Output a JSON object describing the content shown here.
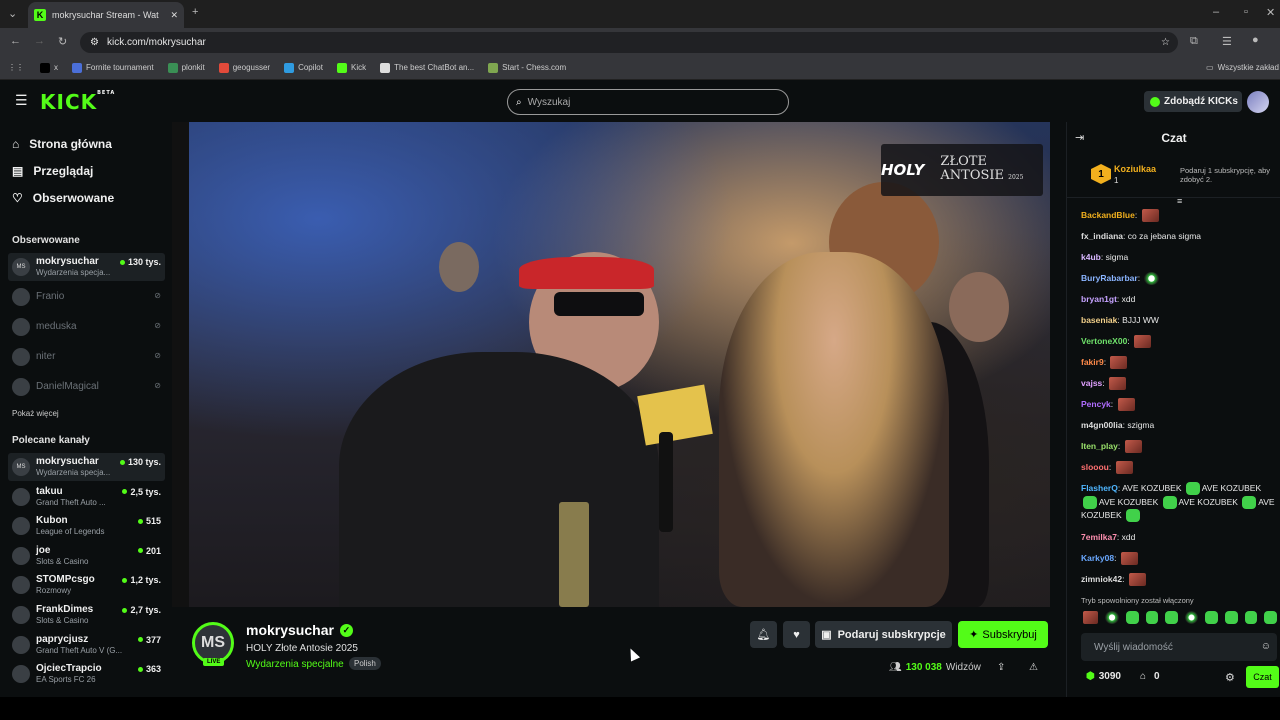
{
  "browser": {
    "tab_title": "mokrysuchar Stream - Wat",
    "url": "kick.com/mokrysuchar",
    "bookmarks": [
      {
        "label": "x",
        "color": "#000000"
      },
      {
        "label": "Fornite tournament",
        "color": "#4b6fd8"
      },
      {
        "label": "plonkit",
        "color": "#3a8f55"
      },
      {
        "label": "geogusser",
        "color": "#e24a3a"
      },
      {
        "label": "Copilot",
        "color": "#2f9be0"
      },
      {
        "label": "Kick",
        "color": "#53fc18"
      },
      {
        "label": "The best ChatBot an...",
        "color": "#dddddd"
      },
      {
        "label": "Start - Chess.com",
        "color": "#7fa650"
      }
    ],
    "other_bookmarks": "Wszystkie zakład"
  },
  "header": {
    "logo": "KICK",
    "logo_sup": "BETA",
    "search_placeholder": "Wyszukaj",
    "get_kicks": "Zdobądź KICKs"
  },
  "sidebar": {
    "nav": [
      "Strona główna",
      "Przeglądaj",
      "Obserwowane"
    ],
    "followed_title": "Obserwowane",
    "followed": [
      {
        "initials": "MS",
        "name": "mokrysuchar",
        "category": "Wydarzenia specja...",
        "viewers": "130 tys.",
        "live": true
      },
      {
        "initials": "",
        "name": "Franio",
        "live": false
      },
      {
        "initials": "",
        "name": "meduska",
        "live": false
      },
      {
        "initials": "",
        "name": "niter",
        "live": false
      },
      {
        "initials": "",
        "name": "DanielMagical",
        "live": false
      }
    ],
    "show_more": "Pokaż więcej",
    "recommended_title": "Polecane kanały",
    "recommended": [
      {
        "initials": "MS",
        "name": "mokrysuchar",
        "category": "Wydarzenia specja...",
        "viewers": "130 tys."
      },
      {
        "initials": "",
        "name": "takuu",
        "category": "Grand Theft Auto ...",
        "viewers": "2,5 tys."
      },
      {
        "initials": "",
        "name": "Kubon",
        "category": "League of Legends",
        "viewers": "515"
      },
      {
        "initials": "",
        "name": "joe",
        "category": "Slots & Casino",
        "viewers": "201"
      },
      {
        "initials": "",
        "name": "STOMPcsgo",
        "category": "Rozmowy",
        "viewers": "1,2 tys."
      },
      {
        "initials": "",
        "name": "FrankDimes",
        "category": "Slots & Casino",
        "viewers": "2,7 tys."
      },
      {
        "initials": "",
        "name": "paprycjusz",
        "category": "Grand Theft Auto V (G...",
        "viewers": "377"
      },
      {
        "initials": "",
        "name": "OjciecTrapcio",
        "category": "EA Sports FC 26",
        "viewers": "363"
      }
    ]
  },
  "video": {
    "overlay_brand": "HOLY",
    "overlay_title": "ZŁOTE ANTOSIE",
    "overlay_year": "2025"
  },
  "stream": {
    "initials": "MS",
    "live": "LIVE",
    "channel": "mokrysuchar",
    "title": "HOLY Złote Antosie 2025",
    "category": "Wydarzenia specjalne",
    "language": "Polish",
    "gift_label": "Podaruj subskrypcje",
    "subscribe_label": "Subskrybuj",
    "viewers": "130 038",
    "viewers_label": "Widzów"
  },
  "chat": {
    "title": "Czat",
    "pinned_user": "Koziulkaa",
    "pinned_rank": "1",
    "pinned_count": "1",
    "pinned_note": "Podaruj 1 subskrypcję, aby zdobyć 2.",
    "messages": [
      {
        "user": "BackandBlue",
        "color": "#f2b01e",
        "text": "",
        "emotes": [
          "face"
        ]
      },
      {
        "user": "fx_indiana",
        "color": "#dddddd",
        "text": "co za jebana sigma",
        "emotes": []
      },
      {
        "user": "k4ub",
        "color": "#d8b7ff",
        "text": "sigma",
        "emotes": []
      },
      {
        "user": "BuryRabarbar",
        "color": "#8ab4ff",
        "text": "",
        "emotes": [
          "ball"
        ]
      },
      {
        "user": "bryan1gt",
        "color": "#c6a3ff",
        "text": "xdd",
        "emotes": []
      },
      {
        "user": "baseniak",
        "color": "#f2d08a",
        "text": "BJJJ WW",
        "emotes": []
      },
      {
        "user": "VertoneX00",
        "color": "#6fe26b",
        "text": "",
        "emotes": [
          "face"
        ]
      },
      {
        "user": "fakir9",
        "color": "#ff8a4a",
        "text": "",
        "emotes": [
          "face"
        ]
      },
      {
        "user": "vajss",
        "color": "#e0a0ff",
        "text": "",
        "emotes": [
          "face"
        ]
      },
      {
        "user": "Pencyk",
        "color": "#b06cff",
        "text": "",
        "emotes": [
          "face"
        ]
      },
      {
        "user": "m4gn00lia",
        "color": "#ddd",
        "text": "szigma",
        "emotes": []
      },
      {
        "user": "Iten_play",
        "color": "#9ae26b",
        "text": "",
        "emotes": [
          "face"
        ]
      },
      {
        "user": "slooou",
        "color": "#ff7070",
        "text": "",
        "emotes": [
          "face"
        ]
      },
      {
        "user": "FlasherQ",
        "color": "#4fb6ff",
        "text": "AVE KOZUBEK",
        "emotes": []
      },
      {
        "user": "7emilka7",
        "color": "#ff8fb0",
        "text": "xdd",
        "emotes": []
      },
      {
        "user": "Karky08",
        "color": "#6aa8ff",
        "text": "",
        "emotes": [
          "face"
        ]
      },
      {
        "user": "zimniok42",
        "color": "#dddddd",
        "text": "",
        "emotes": [
          "face"
        ]
      }
    ],
    "slow_mode": "Tryb spowolniony został włączony",
    "input_placeholder": "Wyślij wiadomość",
    "kicks": "3090",
    "bag": "0",
    "send": "Czat"
  }
}
